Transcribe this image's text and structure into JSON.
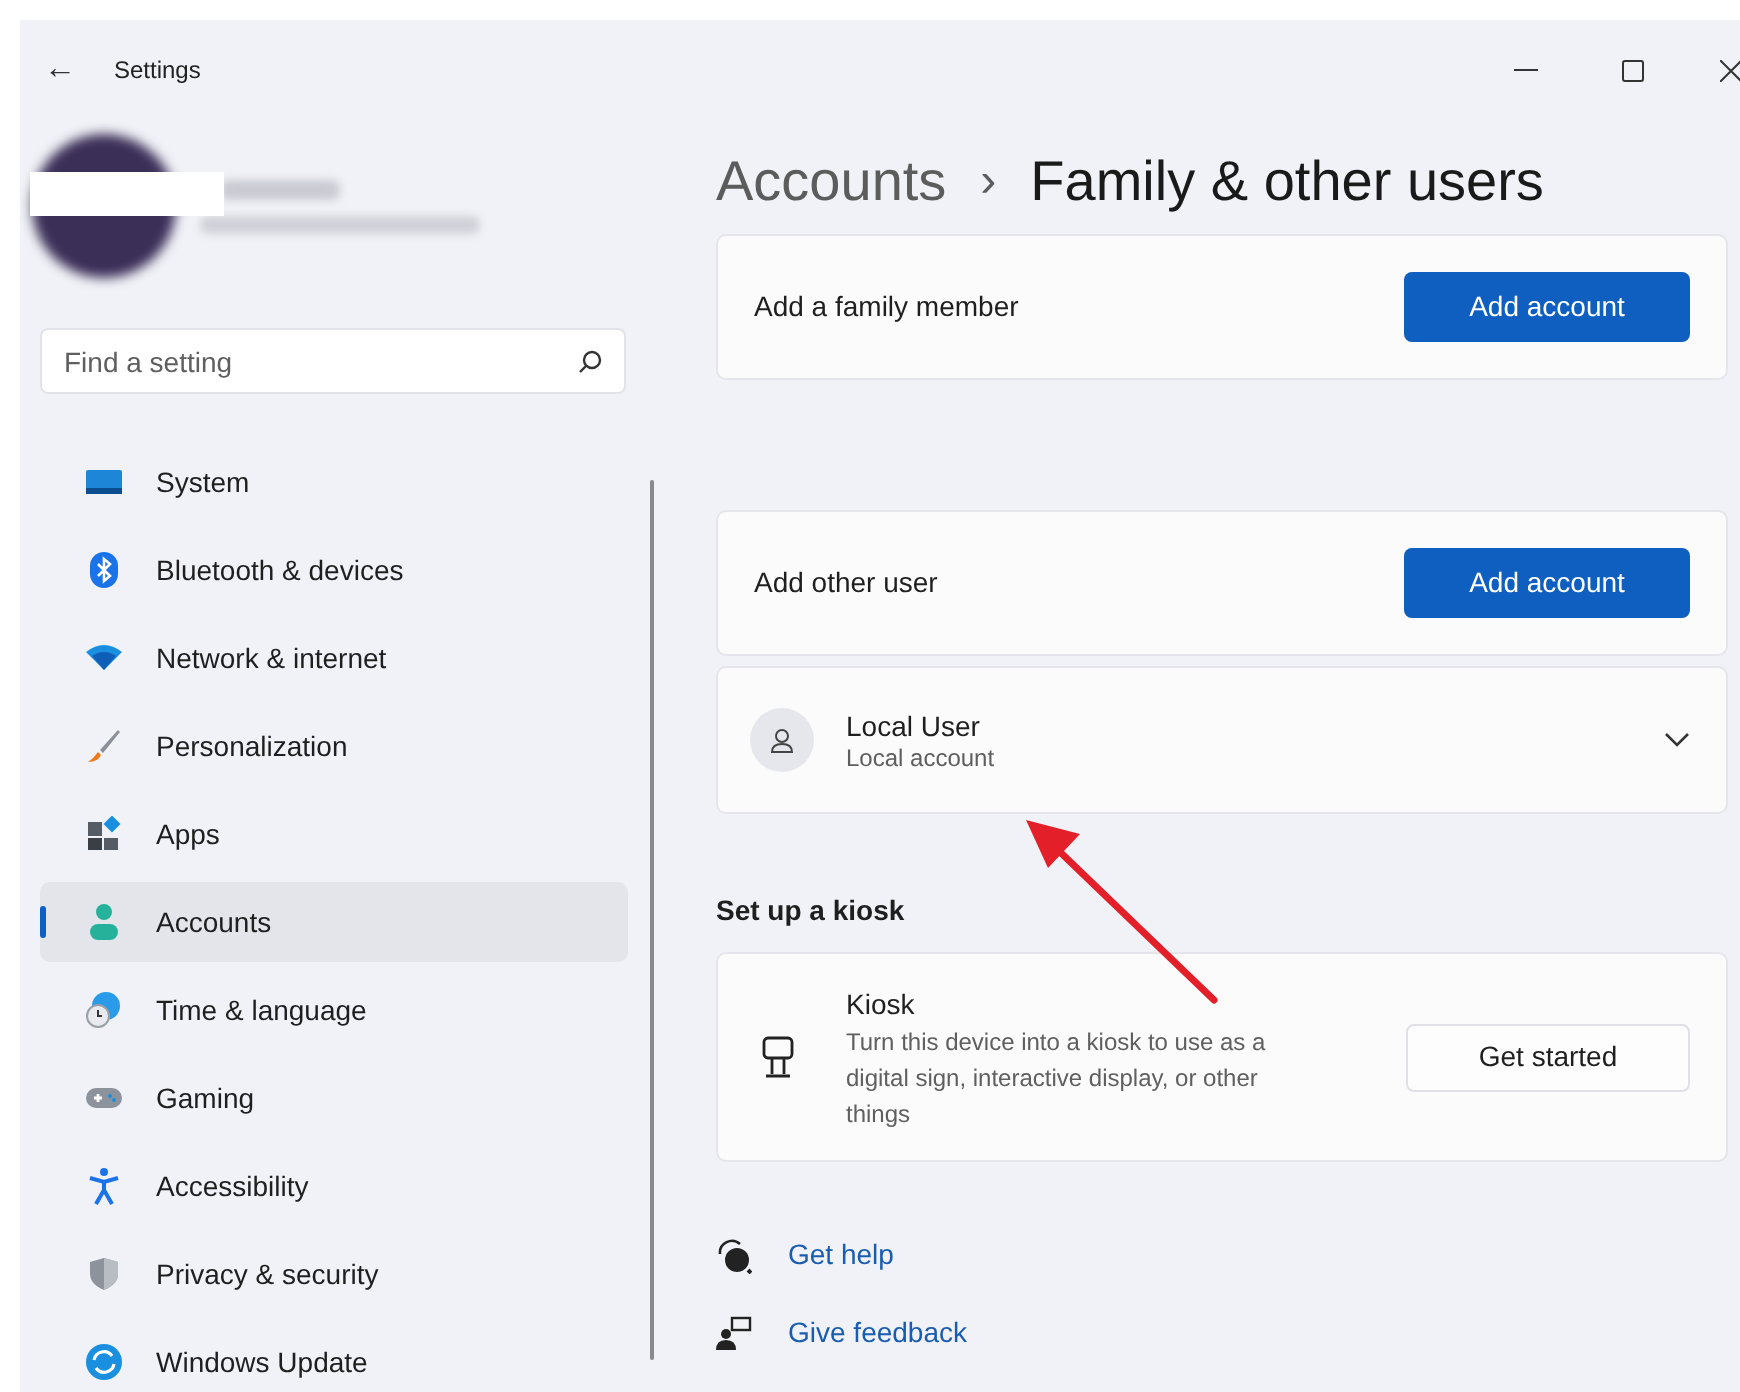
{
  "window": {
    "title": "Settings",
    "back": "←"
  },
  "search": {
    "placeholder": "Find a setting"
  },
  "sidebar": {
    "items": [
      {
        "label": "System",
        "selected": false
      },
      {
        "label": "Bluetooth & devices",
        "selected": false
      },
      {
        "label": "Network & internet",
        "selected": false
      },
      {
        "label": "Personalization",
        "selected": false
      },
      {
        "label": "Apps",
        "selected": false
      },
      {
        "label": "Accounts",
        "selected": true
      },
      {
        "label": "Time & language",
        "selected": false
      },
      {
        "label": "Gaming",
        "selected": false
      },
      {
        "label": "Accessibility",
        "selected": false
      },
      {
        "label": "Privacy & security",
        "selected": false
      },
      {
        "label": "Windows Update",
        "selected": false
      }
    ]
  },
  "breadcrumb": {
    "parent": "Accounts",
    "separator": "›",
    "current": "Family & other users"
  },
  "family": {
    "label": "Add a family member",
    "button": "Add account"
  },
  "other_users": {
    "label": "Add other user",
    "button": "Add account",
    "users": [
      {
        "name": "Local User",
        "detail": "Local account",
        "expanded": false
      }
    ]
  },
  "kiosk": {
    "heading": "Set up a kiosk",
    "title": "Kiosk",
    "description": "Turn this device into a kiosk to use as a digital sign, interactive display, or other things",
    "button": "Get started"
  },
  "links": [
    "Get help",
    "Give feedback"
  ]
}
